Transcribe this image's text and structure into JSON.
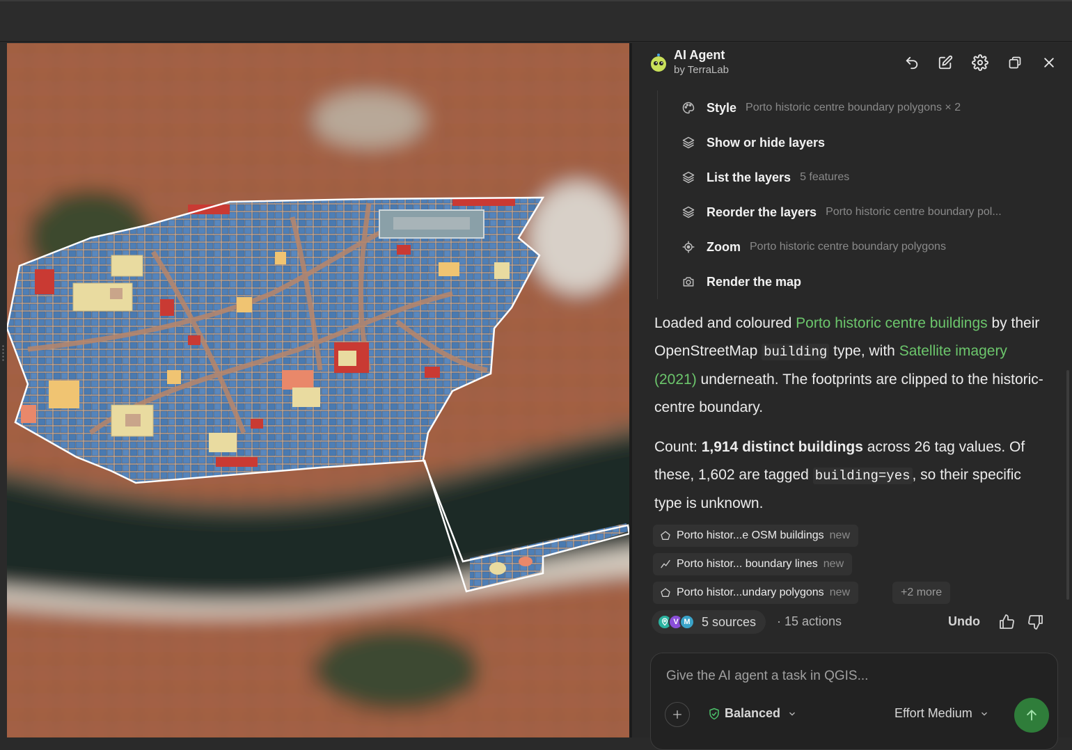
{
  "colors": {
    "accent_green": "#6cc66c",
    "send_button": "#2f7d3a",
    "panel_bg": "#282828",
    "building_blue": "#4f7fb5",
    "building_red": "#c93a33",
    "building_cream": "#e9dba0",
    "boundary_line": "#ffffff"
  },
  "header": {
    "title": "AI Agent",
    "subtitle": "by TerraLab",
    "icons": [
      "undo-icon",
      "edit-icon",
      "gear-icon",
      "popout-icon",
      "close-icon"
    ]
  },
  "actions": [
    {
      "label": "Style",
      "detail": "Porto historic centre boundary polygons   × 2",
      "icon": "palette-icon"
    },
    {
      "label": "Show or hide layers",
      "detail": "",
      "icon": "layers-icon"
    },
    {
      "label": "List the layers",
      "detail": "5 features",
      "icon": "layers-icon"
    },
    {
      "label": "Reorder the layers",
      "detail": "Porto historic centre boundary pol...",
      "icon": "layers-icon"
    },
    {
      "label": "Zoom",
      "detail": "Porto historic centre boundary polygons",
      "icon": "crosshair-icon"
    },
    {
      "label": "Render the map",
      "detail": "",
      "icon": "camera-icon"
    }
  ],
  "message1": {
    "t1": "Loaded and coloured ",
    "link1": "Porto historic centre buildings",
    "t2": " by their OpenStreetMap ",
    "code1": "building",
    "t3": " type, with ",
    "link2": "Satellite imagery (2021)",
    "t4": " underneath. The footprints are clipped to the historic-centre boundary."
  },
  "message2": {
    "t1": "Count: ",
    "bold1": "1,914 distinct buildings",
    "t2": " across 26 tag values. Of these, 1,602 are tagged ",
    "code1": "building=yes",
    "t3": ", so their specific type is unknown."
  },
  "chips": [
    {
      "label": "Porto histor...e OSM buildings",
      "tag": "new",
      "icon": "polygon-icon"
    },
    {
      "label": "Porto histor... boundary lines",
      "tag": "new",
      "icon": "line-icon"
    },
    {
      "label": "Porto histor...undary polygons",
      "tag": "new",
      "icon": "polygon-icon"
    }
  ],
  "more_chip": "+2 more",
  "footer": {
    "sources": "5 sources",
    "actions_count": "· 15 actions",
    "undo": "Undo",
    "badges": [
      "V",
      "M"
    ]
  },
  "input": {
    "placeholder": "Give the AI agent a task in QGIS...",
    "mode": "Balanced",
    "effort": "Effort Medium"
  }
}
